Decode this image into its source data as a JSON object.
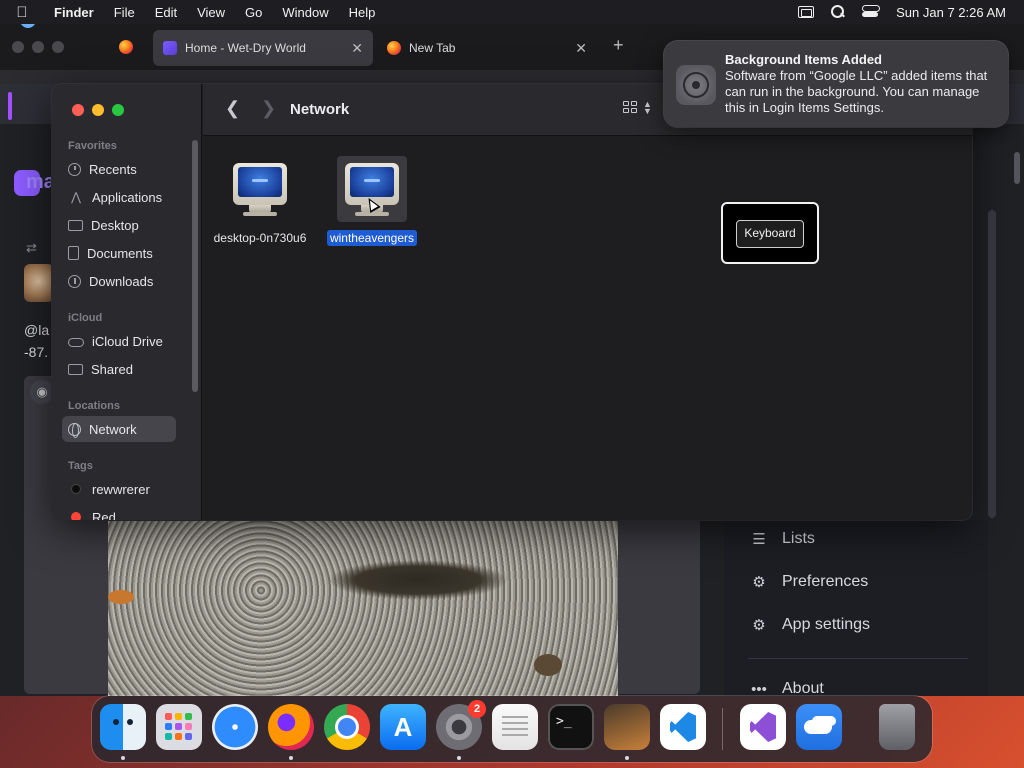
{
  "menubar": {
    "app_name": "Finder",
    "items": [
      "File",
      "Edit",
      "View",
      "Go",
      "Window",
      "Help"
    ],
    "clock": "Sun Jan 7  2:26 AM"
  },
  "browser": {
    "tabs": [
      {
        "label": "Home - Wet-Dry World",
        "active": true
      },
      {
        "label": "New Tab",
        "active": false
      }
    ],
    "info_text": "It",
    "logo_text": "ma",
    "handle": "@la",
    "coords": "-87.",
    "side_menu": [
      {
        "label": "Lists",
        "icon": "list-icon"
      },
      {
        "label": "Preferences",
        "icon": "gear-icon"
      },
      {
        "label": "App settings",
        "icon": "gears-icon"
      },
      {
        "label": "About",
        "icon": "ellipsis-icon"
      }
    ]
  },
  "finder": {
    "title": "Network",
    "sidebar": {
      "favorites_heading": "Favorites",
      "favorites": [
        "Recents",
        "Applications",
        "Desktop",
        "Documents",
        "Downloads"
      ],
      "icloud_heading": "iCloud",
      "icloud": [
        "iCloud Drive",
        "Shared"
      ],
      "locations_heading": "Locations",
      "locations": [
        "Network"
      ],
      "tags_heading": "Tags",
      "tags": [
        {
          "label": "rewwrerer",
          "color": "#0d0d0d"
        },
        {
          "label": "Red",
          "color": "#ff453a"
        }
      ]
    },
    "files": [
      {
        "label": "desktop-0n730u6",
        "selected": false
      },
      {
        "label": "wintheavengers",
        "selected": true
      }
    ]
  },
  "keyboard_overlay": {
    "label": "Keyboard"
  },
  "notification": {
    "title": "Background Items Added",
    "body": "Software from “Google LLC” added items that can run in the background. You can manage this in Login Items Settings."
  },
  "dock": {
    "apps": [
      "Finder",
      "Launchpad",
      "Safari",
      "Firefox",
      "Google Chrome",
      "App Store",
      "System Settings",
      "TextEdit",
      "Terminal",
      "GarageBand",
      "Visual Studio Code",
      "Visual Studio",
      "Weather",
      "Trash"
    ],
    "settings_badge": "2"
  },
  "colors": {
    "selection": "#1f5bd1",
    "accent_purple": "#8c5cff",
    "badge_red": "#ff3b30"
  }
}
